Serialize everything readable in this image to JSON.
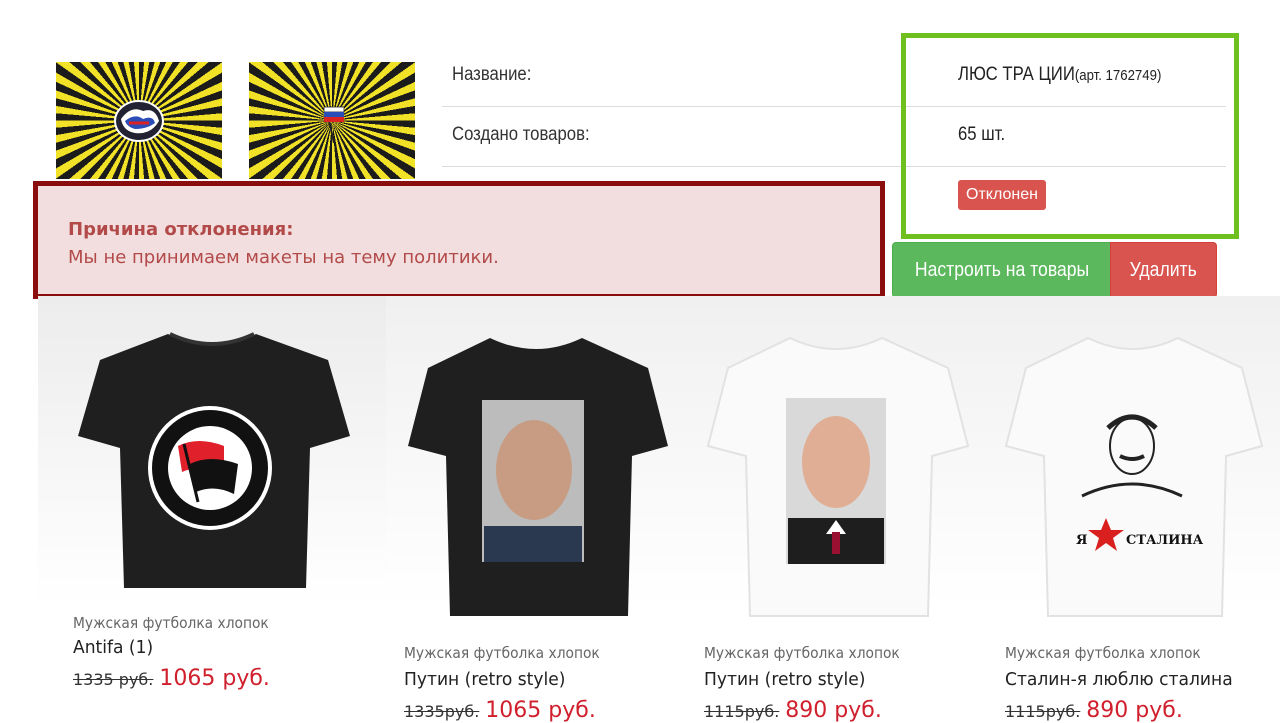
{
  "design": {
    "thumbnails": [
      {
        "icon": "graffiti-logo-icon"
      },
      {
        "icon": "flag-icon"
      }
    ]
  },
  "info": {
    "name_label": "Название:",
    "name_value": "ЛЮС ТРА ЦИИ",
    "article": "(арт. 1762749)",
    "count_label": "Создано товаров:",
    "count_value": "65 шт.",
    "status": "Отклонен"
  },
  "alert": {
    "title": "Причина отклонения:",
    "text": "Мы не принимаем макеты на тему политики."
  },
  "actions": {
    "configure": "Настроить на товары",
    "delete": "Удалить"
  },
  "products": [
    {
      "type": "Мужская футболка хлопок",
      "name": "Antifa (1)",
      "old_price": "1335 руб.",
      "new_price": "1065 руб.",
      "shirt_color": "black",
      "print": "antifa-logo-icon"
    },
    {
      "type": "Мужская футболка хлопок",
      "name": "Путин (retro style)",
      "old_price": "1335руб.",
      "new_price": "1065 руб.",
      "shirt_color": "black",
      "print": "portrait-icon"
    },
    {
      "type": "Мужская футболка хлопок",
      "name": "Путин (retro style)",
      "old_price": "1115руб.",
      "new_price": "890 руб.",
      "shirt_color": "white",
      "print": "portrait-icon"
    },
    {
      "type": "Мужская футболка хлопок",
      "name": "Сталин-я люблю сталина",
      "old_price": "1115руб.",
      "new_price": "890 руб.",
      "shirt_color": "white",
      "print": "stalin-print-icon",
      "print_text": "Я СТАЛИНА"
    }
  ],
  "colors": {
    "accent_green": "#6fbf1f",
    "alert_border": "#8a0e0e",
    "danger": "#d9534f",
    "success": "#5cb85c",
    "price_red": "#d0202d"
  }
}
